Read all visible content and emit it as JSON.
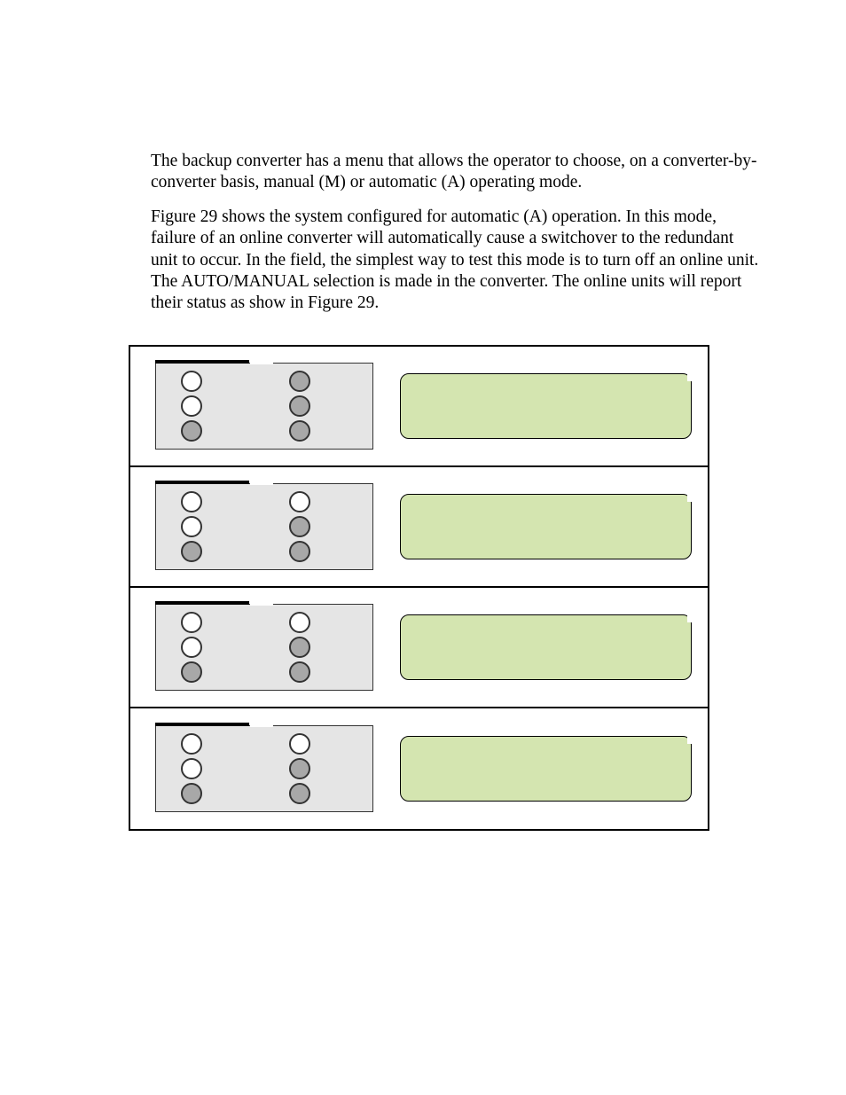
{
  "paragraphs": {
    "p1": "The backup converter has a menu that allows the operator to choose, on a converter-by-converter basis, manual (M) or automatic (A) operating mode.",
    "p2": "Figure 29 shows the system configured for automatic (A) operation.  In this mode, failure of an online converter will automatically cause a switchover to the redundant unit to occur.  In the field, the simplest way to test this mode is to turn off an online unit. The AUTO/MANUAL selection is made in the converter. The online units will report their status as show in Figure 29."
  },
  "figure": {
    "rows": [
      {
        "left_leds": [
          "off",
          "off",
          "on"
        ],
        "right_leds": [
          "on",
          "on",
          "on"
        ],
        "display_text": ""
      },
      {
        "left_leds": [
          "off",
          "off",
          "on"
        ],
        "right_leds": [
          "off",
          "on",
          "on"
        ],
        "display_text": ""
      },
      {
        "left_leds": [
          "off",
          "off",
          "on"
        ],
        "right_leds": [
          "off",
          "on",
          "on"
        ],
        "display_text": ""
      },
      {
        "left_leds": [
          "off",
          "off",
          "on"
        ],
        "right_leds": [
          "off",
          "on",
          "on"
        ],
        "display_text": ""
      }
    ]
  }
}
